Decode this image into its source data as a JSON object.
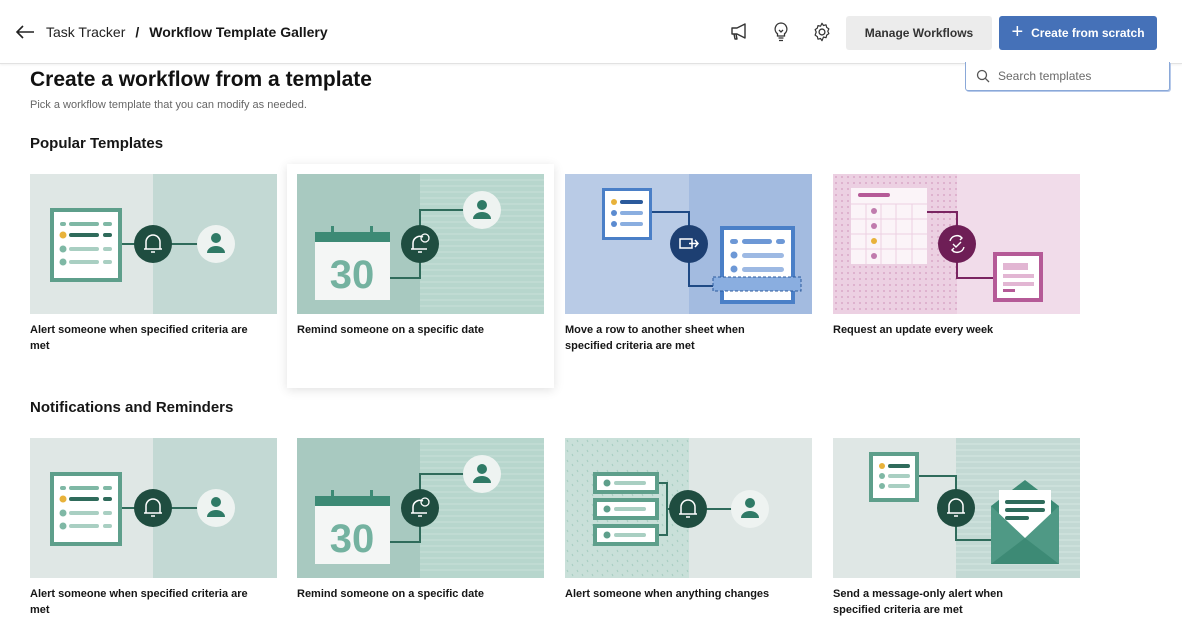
{
  "header": {
    "back_label": "Back",
    "breadcrumb_parent": "Task Tracker",
    "breadcrumb_separator": "/",
    "breadcrumb_current": "Workflow Template Gallery",
    "icons": [
      "megaphone-icon",
      "lightbulb-icon",
      "gear-icon"
    ],
    "manage_button": "Manage Workflows",
    "create_button": "Create from scratch",
    "primary_color": "#4571b8"
  },
  "search": {
    "placeholder": "Search templates",
    "value": ""
  },
  "page": {
    "title": "Create a workflow from a template",
    "subtitle": "Pick a workflow template that you can modify as needed."
  },
  "sections": [
    {
      "title": "Popular Templates",
      "templates": [
        {
          "label": "Alert someone when specified criteria are met",
          "illustration": "alert-criteria",
          "theme": "green"
        },
        {
          "label": "Remind someone on a specific date",
          "illustration": "remind-date",
          "theme": "green",
          "hovered": true,
          "calendar_day": "30"
        },
        {
          "label": "Move a row to another sheet when specified criteria are met",
          "illustration": "move-row",
          "theme": "blue"
        },
        {
          "label": "Request an update every week",
          "illustration": "request-update",
          "theme": "pink"
        }
      ]
    },
    {
      "title": "Notifications and Reminders",
      "templates": [
        {
          "label": "Alert someone when specified criteria are met",
          "illustration": "alert-criteria",
          "theme": "green"
        },
        {
          "label": "Remind someone on a specific date",
          "illustration": "remind-date",
          "theme": "green",
          "calendar_day": "30"
        },
        {
          "label": "Alert someone when anything changes",
          "illustration": "alert-changes",
          "theme": "green"
        },
        {
          "label": "Send a message-only alert when specified criteria are met",
          "illustration": "message-alert",
          "theme": "green"
        }
      ]
    }
  ]
}
